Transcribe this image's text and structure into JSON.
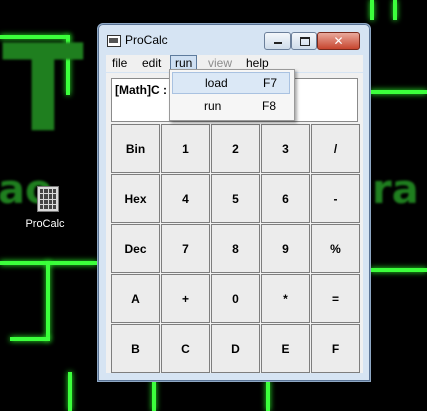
{
  "desktop": {
    "icon_label": "ProCalc",
    "accent": "#3cff3c"
  },
  "window": {
    "title": "ProCalc",
    "close_glyph": "✕"
  },
  "menubar": {
    "items": [
      {
        "label": "file",
        "state": "normal"
      },
      {
        "label": "edit",
        "state": "normal"
      },
      {
        "label": "run",
        "state": "open"
      },
      {
        "label": "view",
        "state": "disabled"
      },
      {
        "label": "help",
        "state": "normal"
      }
    ]
  },
  "run_menu": {
    "items": [
      {
        "label": "load",
        "shortcut": "F7",
        "highlighted": true
      },
      {
        "label": "run",
        "shortcut": "F8",
        "highlighted": false
      }
    ]
  },
  "display": {
    "text": "[Math]C :"
  },
  "keypad": {
    "rows": [
      [
        "Bin",
        "1",
        "2",
        "3",
        "/"
      ],
      [
        "Hex",
        "4",
        "5",
        "6",
        "-"
      ],
      [
        "Dec",
        "7",
        "8",
        "9",
        "%"
      ],
      [
        "A",
        "+",
        "0",
        "*",
        "="
      ],
      [
        "B",
        "C",
        "D",
        "E",
        "F"
      ]
    ]
  }
}
